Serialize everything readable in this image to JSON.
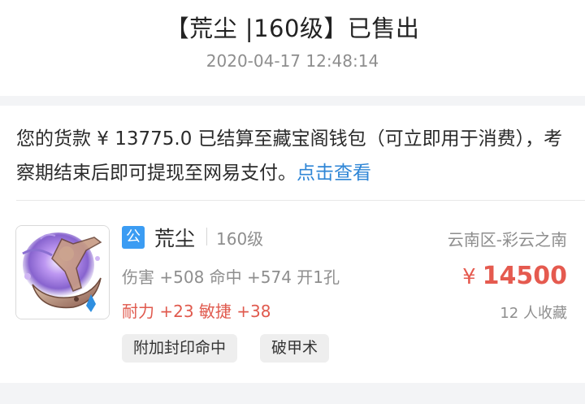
{
  "header": {
    "title": "【荒尘 |160级】已售出",
    "time": "2020-04-17 12:48:14"
  },
  "notice": {
    "text": "您的货款 ¥ 13775.0 已结算至藏宝阁钱包（可立即用于消费），考察期结束后即可提现至网易支付。",
    "link": "点击查看"
  },
  "item": {
    "icon": "moon-wing-weapon-icon",
    "badge": "公",
    "name": "荒尘",
    "level": "160级",
    "server": "云南区-彩云之南",
    "stats_primary": "伤害 +508 命中 +574 开1孔",
    "stats_secondary": "耐力 +23 敏捷 +38",
    "price_symbol": "¥",
    "price": "14500",
    "favorites": "12 人收藏",
    "tags": [
      "附加封印命中",
      "破甲术"
    ]
  },
  "colors": {
    "accent_blue": "#2f86d6",
    "badge_blue": "#3b9cf3",
    "price_red": "#e55a4f",
    "stat_red": "#e05a4e"
  }
}
